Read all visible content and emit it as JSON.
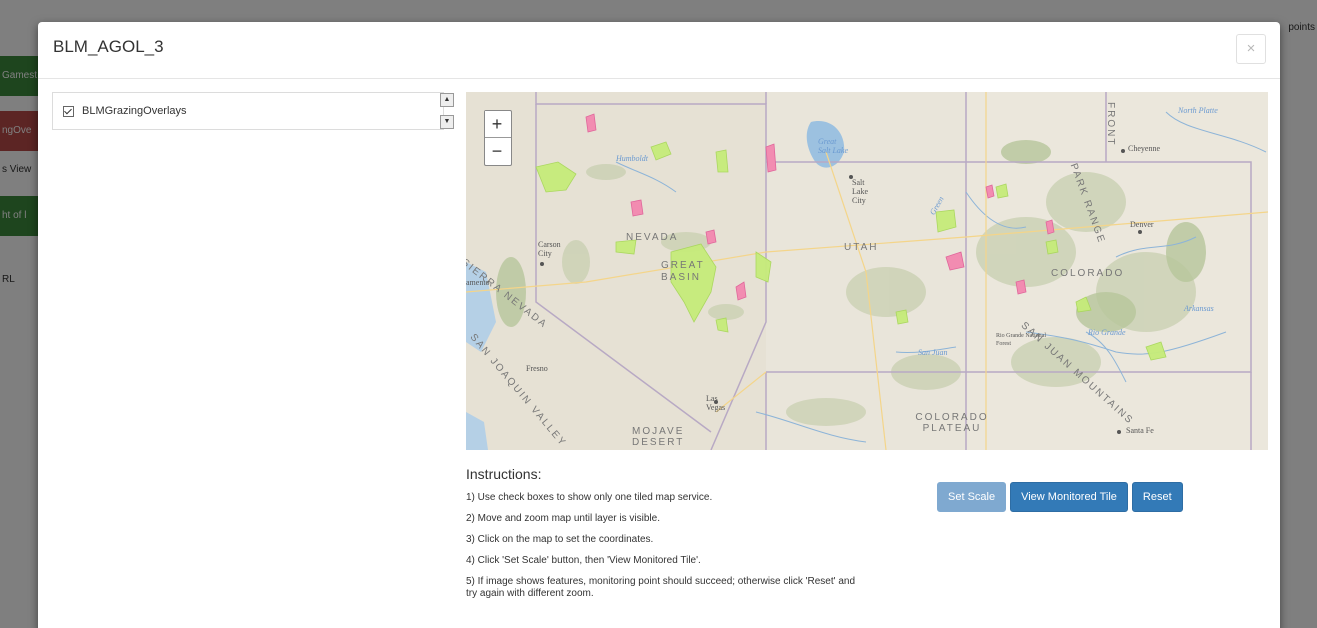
{
  "background": {
    "pills": [
      {
        "label": "Gamest",
        "kind": "green"
      },
      {
        "label": "ngOve",
        "kind": "red"
      },
      {
        "label": "s View",
        "kind": "plain"
      },
      {
        "label": "ht of l",
        "kind": "green"
      },
      {
        "label": "RL",
        "kind": "plain"
      }
    ],
    "right_text": "points"
  },
  "modal": {
    "title": "BLM_AGOL_3",
    "close_label": "×"
  },
  "layers": [
    {
      "label": "BLMGrazingOverlays",
      "checked": true
    }
  ],
  "map": {
    "zoom_in": "+",
    "zoom_out": "−",
    "labels": {
      "north_platte": "North Platte",
      "cheyenne": "Cheyenne",
      "denver": "Denver",
      "humboldt": "Humboldt",
      "great_salt_lake": "Great Salt Lake",
      "salt_lake_city": "Salt Lake City",
      "nevada": "NEVADA",
      "utah": "UTAH",
      "colorado": "COLORADO",
      "carson_city": "Carson City",
      "sierra_nevada": "SIERRA NEVADA",
      "san_joaquin_valley": "SAN JOAQUIN VALLEY",
      "fresno": "Fresno",
      "las_vegas": "Las Vegas",
      "mojave_desert": "MOJAVE DESERT",
      "colorado_plateau": "COLORADO PLATEAU",
      "santa_fe": "Santa Fe",
      "arkansas": "Arkansas",
      "rio_grande": "Rio Grande",
      "park_range": "PARK RANGE",
      "san_juan_mountains": "SAN JUAN MOUNTAINS",
      "front_range": "FRONT",
      "great_basin": "GREAT BASIN",
      "green": "Green",
      "san_juan": "San Juan",
      "sacramento": "amento",
      "rio_grande_nf": "Rio Grande National Forest"
    }
  },
  "instructions": {
    "title": "Instructions:",
    "steps": [
      "1) Use check boxes to show only one tiled map service.",
      "2) Move and zoom map until layer is visible.",
      "3) Click on the map to set the coordinates.",
      "4) Click 'Set Scale' button, then 'View Monitored Tile'.",
      "5) If image shows features, monitoring point should succeed; otherwise click 'Reset' and try again with different zoom."
    ]
  },
  "buttons": {
    "set_scale": "Set Scale",
    "view_tile": "View Monitored Tile",
    "reset": "Reset"
  }
}
